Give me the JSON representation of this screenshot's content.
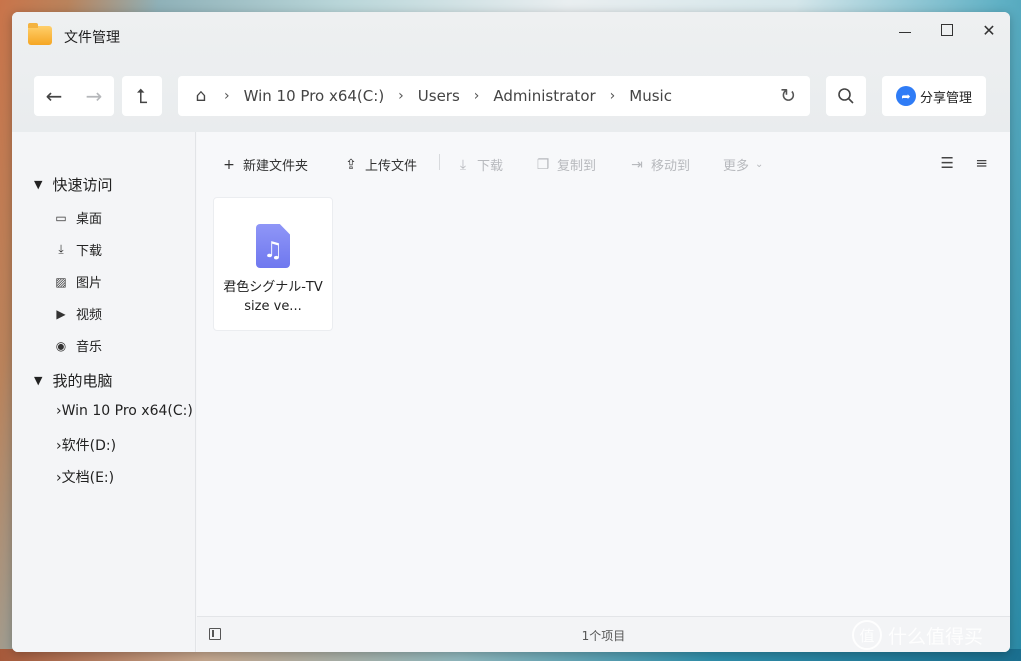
{
  "window": {
    "title": "文件管理"
  },
  "nav": {
    "back_icon": "←",
    "forward_icon": "→",
    "up_icon": "⮤",
    "home_icon": "⌂"
  },
  "breadcrumb": [
    "Win 10 Pro x64(C:)",
    "Users",
    "Administrator",
    "Music"
  ],
  "share": {
    "label": "分享管理",
    "color": "#2f7cf6"
  },
  "sidebar": {
    "quick_access": {
      "label": "快速访问"
    },
    "quick_items": [
      {
        "label": "桌面",
        "icon": "desktop-icon"
      },
      {
        "label": "下载",
        "icon": "download-icon"
      },
      {
        "label": "图片",
        "icon": "image-icon"
      },
      {
        "label": "视频",
        "icon": "video-icon"
      },
      {
        "label": "音乐",
        "icon": "music-icon"
      }
    ],
    "my_computer": {
      "label": "我的电脑"
    },
    "drives": [
      "Win 10 Pro x64(C:)",
      "软件(D:)",
      "文档(E:)"
    ]
  },
  "toolbar": {
    "new_folder": "新建文件夹",
    "upload": "上传文件",
    "download": "下载",
    "copy_to": "复制到",
    "move_to": "移动到",
    "more": "更多"
  },
  "files": [
    {
      "name": "君色シグナル-TV size ve...",
      "type": "audio",
      "icon_color": "#7b82f4"
    }
  ],
  "status": {
    "item_count": "1个项目"
  },
  "watermark": {
    "text": "什么值得买",
    "glyph": "值"
  }
}
